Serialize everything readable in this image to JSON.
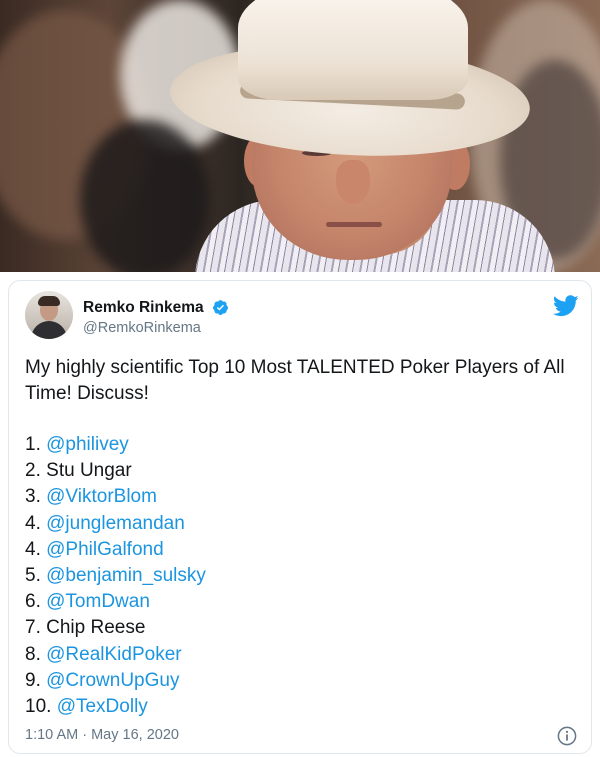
{
  "tweet": {
    "author_name": "Remko Rinkema",
    "author_handle": "@RemkoRinkema",
    "text": "My highly scientific Top 10 Most TALENTED Poker Players of All Time! Discuss!",
    "list": [
      {
        "number": "1.",
        "name": "@philivey",
        "is_mention": true
      },
      {
        "number": "2.",
        "name": "Stu Ungar",
        "is_mention": false
      },
      {
        "number": "3.",
        "name": "@ViktorBlom",
        "is_mention": true
      },
      {
        "number": "4.",
        "name": "@junglemandan",
        "is_mention": true
      },
      {
        "number": "4.",
        "name": "@PhilGalfond",
        "is_mention": true
      },
      {
        "number": "5.",
        "name": "@benjamin_sulsky",
        "is_mention": true
      },
      {
        "number": "6.",
        "name": "@TomDwan",
        "is_mention": true
      },
      {
        "number": "7.",
        "name": "Chip Reese",
        "is_mention": false
      },
      {
        "number": "8.",
        "name": "@RealKidPoker",
        "is_mention": true
      },
      {
        "number": "9.",
        "name": "@CrownUpGuy",
        "is_mention": true
      },
      {
        "number": "10.",
        "name": "@TexDolly",
        "is_mention": true
      }
    ],
    "timestamp": "1:10 AM · May 16, 2020"
  },
  "icons": {
    "verified": "verified-badge-icon",
    "brand": "twitter-bird-icon",
    "info": "info-icon"
  },
  "colors": {
    "mention": "#1b95e0",
    "brand": "#1da1f2",
    "secondary_text": "#657786",
    "primary_text": "#14171a"
  }
}
